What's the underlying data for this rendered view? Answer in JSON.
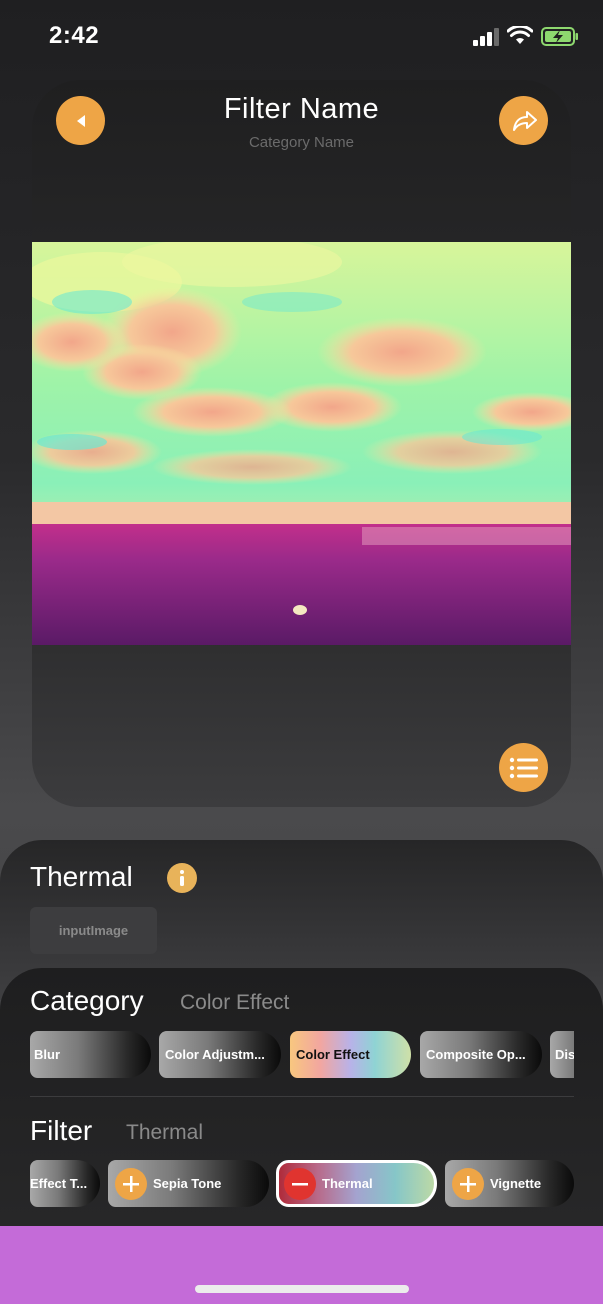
{
  "status_bar": {
    "time": "2:42"
  },
  "preview": {
    "title": "Filter Name",
    "subtitle": "Category Name",
    "image_description_icon": "beach-photo-thermal"
  },
  "filter_panel": {
    "name": "Thermal",
    "input_chip": "inputImage"
  },
  "category": {
    "label": "Category",
    "selected": "Color Effect",
    "chips": [
      "Blur",
      "Color Adjustm...",
      "Color Effect",
      "Composite Op...",
      "Dis"
    ]
  },
  "filter": {
    "label": "Filter",
    "selected": "Thermal",
    "chips": [
      "Effect T...",
      "Sepia Tone",
      "Thermal",
      "Vignette"
    ]
  },
  "colors": {
    "accent": "#eea546",
    "bottom_bar": "#c46bd8",
    "remove": "#e0342f"
  }
}
